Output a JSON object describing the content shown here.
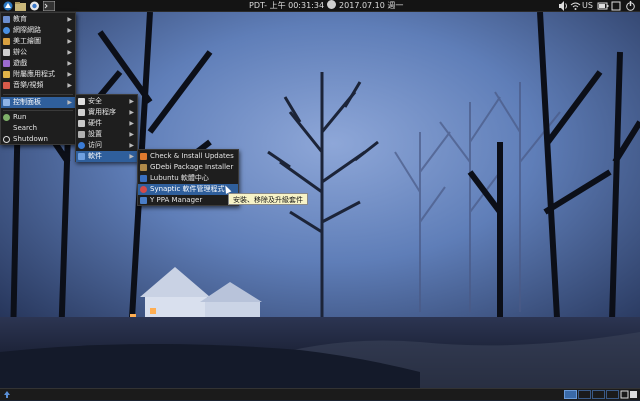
{
  "top_panel": {
    "clock_text": "PDT- 上午 00:31:34",
    "date_text": "2017.07.10 週一",
    "keyboard_layout": "US"
  },
  "main_menu": {
    "items": [
      {
        "label": "教育",
        "icon": "education-icon",
        "has_submenu": true
      },
      {
        "label": "網際網路",
        "icon": "internet-icon",
        "has_submenu": true
      },
      {
        "label": "美工繪圖",
        "icon": "graphics-icon",
        "has_submenu": true
      },
      {
        "label": "辦公",
        "icon": "office-icon",
        "has_submenu": true
      },
      {
        "label": "遊戲",
        "icon": "games-icon",
        "has_submenu": true
      },
      {
        "label": "附屬應用程式",
        "icon": "accessories-icon",
        "has_submenu": true
      },
      {
        "label": "音樂/視頻",
        "icon": "multimedia-icon",
        "has_submenu": true
      },
      {
        "label": "控制面板",
        "icon": "control-panel-icon",
        "has_submenu": true,
        "selected": true
      },
      {
        "label": "Run",
        "icon": "run-icon"
      },
      {
        "label": "Search",
        "icon": "search-icon"
      },
      {
        "label": "Shutdown",
        "icon": "shutdown-icon"
      }
    ]
  },
  "control_submenu": {
    "items": [
      {
        "label": "安全",
        "icon": "security-icon",
        "has_submenu": true
      },
      {
        "label": "實用程序",
        "icon": "utilities-icon",
        "has_submenu": true
      },
      {
        "label": "硬件",
        "icon": "hardware-icon",
        "has_submenu": true
      },
      {
        "label": "設置",
        "icon": "settings-icon",
        "has_submenu": true
      },
      {
        "label": "访问",
        "icon": "access-icon",
        "has_submenu": true
      },
      {
        "label": "軟件",
        "icon": "software-icon",
        "has_submenu": true,
        "selected": true
      }
    ]
  },
  "software_submenu": {
    "items": [
      {
        "label": "Check & Install Updates",
        "icon": "updates-icon"
      },
      {
        "label": "GDebi Package Installer",
        "icon": "package-icon"
      },
      {
        "label": "Lubuntu 軟體中心",
        "icon": "software-center-icon"
      },
      {
        "label": "Synaptic 軟件管理程式",
        "icon": "synaptic-icon",
        "selected": true
      },
      {
        "label": "Y PPA Manager",
        "icon": "ppa-icon"
      }
    ]
  },
  "tooltip": {
    "text": "安裝、移除及升級套件"
  },
  "colors": {
    "menu_bg": "#1e1e1e",
    "highlight": "#2f5f9c",
    "panel": "#141414",
    "tooltip_bg": "#f7f3c7"
  }
}
